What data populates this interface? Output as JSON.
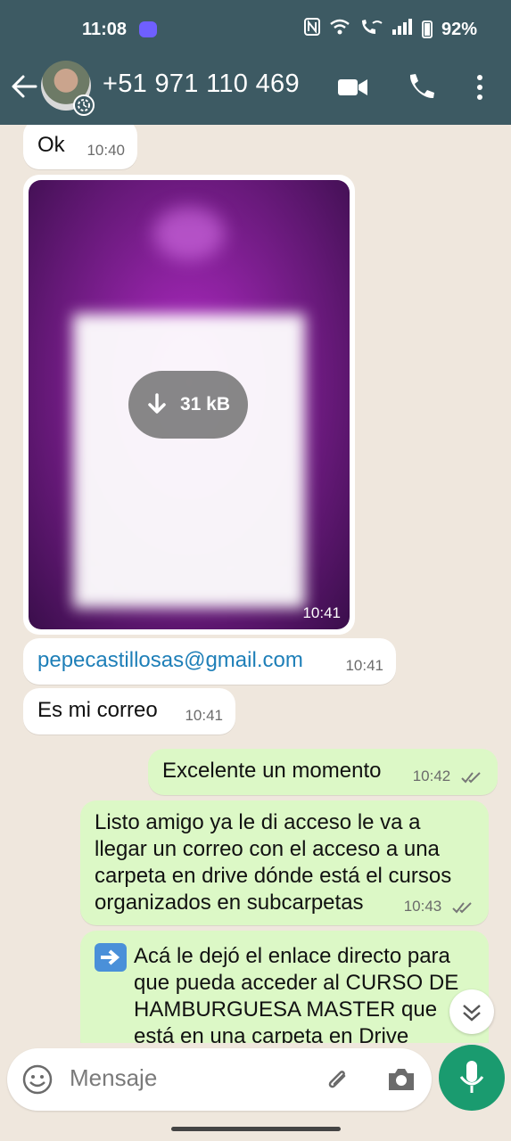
{
  "status_bar": {
    "time": "11:08",
    "battery_percent": "92%"
  },
  "header": {
    "contact_name": "+51 971 110 469"
  },
  "messages": [
    {
      "text": "Ok",
      "time": "10:40"
    },
    {
      "media_size": "31 kB",
      "time": "10:41"
    },
    {
      "text": "pepecastillosas@gmail.com",
      "time": "10:41"
    },
    {
      "text": "Es mi correo",
      "time": "10:41"
    },
    {
      "text": "Excelente un momento",
      "time": "10:42"
    },
    {
      "text": "Listo amigo ya le di acceso le va a llegar un correo con el acceso a una carpeta en drive dónde está el cursos organizados en subcarpetas",
      "time": "10:43"
    },
    {
      "text": "Acá le dejó el enlace directo para que pueda acceder al CURSO DE HAMBURGUESA MASTER que está en una carpeta en Drive"
    }
  ],
  "composer": {
    "placeholder": "Mensaje"
  },
  "colors": {
    "header_bg": "#3d5a63",
    "outgoing_bubble": "#dcf8c6",
    "incoming_bubble": "#ffffff",
    "mic_button": "#1a9b6f",
    "chat_bg": "#efe7dd"
  }
}
